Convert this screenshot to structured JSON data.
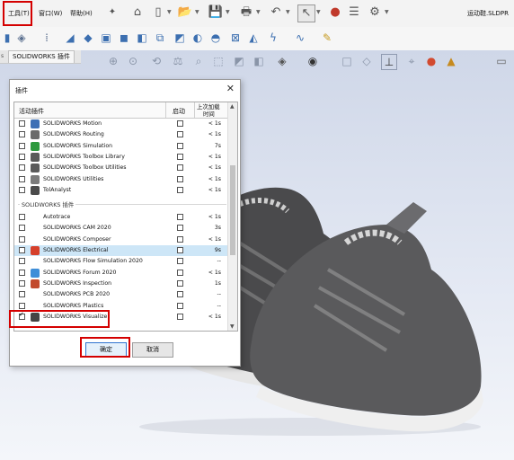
{
  "menubar": {
    "tools_label": "工具(T)",
    "window_label": "窗口(W)",
    "help_label": "帮助(H)",
    "doc_title": "运动鞋.SLDPR"
  },
  "graphics": {
    "tab_label": "SOLIDWORKS 插件"
  },
  "dialog": {
    "title": "插件",
    "close_glyph": "✕",
    "columns": {
      "active": "活动插件",
      "startup": "启动",
      "last_load_line1": "上次加载",
      "last_load_line2": "时间"
    },
    "group1": [
      {
        "name": "SOLIDWORKS Motion",
        "time": "< 1s",
        "active": false,
        "startup": false,
        "icon": "motion-icon",
        "color": "#3d6fb5"
      },
      {
        "name": "SOLIDWORKS Routing",
        "time": "< 1s",
        "active": false,
        "startup": false,
        "icon": "routing-icon",
        "color": "#6a6a6a"
      },
      {
        "name": "SOLIDWORKS Simulation",
        "time": "7s",
        "active": false,
        "startup": false,
        "icon": "simulation-icon",
        "color": "#2e9a3e"
      },
      {
        "name": "SOLIDWORKS Toolbox Library",
        "time": "< 1s",
        "active": false,
        "startup": false,
        "icon": "toolbox-library-icon",
        "color": "#5a5a5a"
      },
      {
        "name": "SOLIDWORKS Toolbox Utilities",
        "time": "< 1s",
        "active": false,
        "startup": false,
        "icon": "toolbox-utilities-icon",
        "color": "#5a5a5a"
      },
      {
        "name": "SOLIDWORKS Utilities",
        "time": "< 1s",
        "active": false,
        "startup": false,
        "icon": "utilities-icon",
        "color": "#7b7b7b"
      },
      {
        "name": "TolAnalyst",
        "time": "< 1s",
        "active": false,
        "startup": false,
        "icon": "tolanalyst-icon",
        "color": "#4b4b4b"
      }
    ],
    "section_label": "SOLIDWORKS 插件",
    "group2": [
      {
        "name": "Autotrace",
        "time": "< 1s",
        "active": false,
        "startup": false,
        "icon": "",
        "color": ""
      },
      {
        "name": "SOLIDWORKS CAM 2020",
        "time": "3s",
        "active": false,
        "startup": false,
        "icon": "",
        "color": ""
      },
      {
        "name": "SOLIDWORKS Composer",
        "time": "< 1s",
        "active": false,
        "startup": false,
        "icon": "",
        "color": ""
      },
      {
        "name": "SOLIDWORKS Electrical",
        "time": "9s",
        "active": false,
        "startup": false,
        "icon": "electrical-icon",
        "color": "#d6402b"
      },
      {
        "name": "SOLIDWORKS Flow Simulation 2020",
        "time": "--",
        "active": false,
        "startup": false,
        "icon": "",
        "color": ""
      },
      {
        "name": "SOLIDWORKS Forum 2020",
        "time": "< 1s",
        "active": false,
        "startup": false,
        "icon": "forum-icon",
        "color": "#3f8ed8"
      },
      {
        "name": "SOLIDWORKS Inspection",
        "time": "1s",
        "active": false,
        "startup": false,
        "icon": "inspection-icon",
        "color": "#c24a2c"
      },
      {
        "name": "SOLIDWORKS PCB 2020",
        "time": "--",
        "active": false,
        "startup": false,
        "icon": "",
        "color": ""
      },
      {
        "name": "SOLIDWORKS Plastics",
        "time": "--",
        "active": false,
        "startup": false,
        "icon": "",
        "color": ""
      },
      {
        "name": "SOLIDWORKS Visualize",
        "time": "< 1s",
        "active": true,
        "startup": false,
        "icon": "visualize-icon",
        "color": "#444444"
      }
    ],
    "ok_label": "确定",
    "cancel_label": "取消"
  },
  "colors": {
    "highlight": "#d40000",
    "selected_row": "#cde6f7"
  }
}
